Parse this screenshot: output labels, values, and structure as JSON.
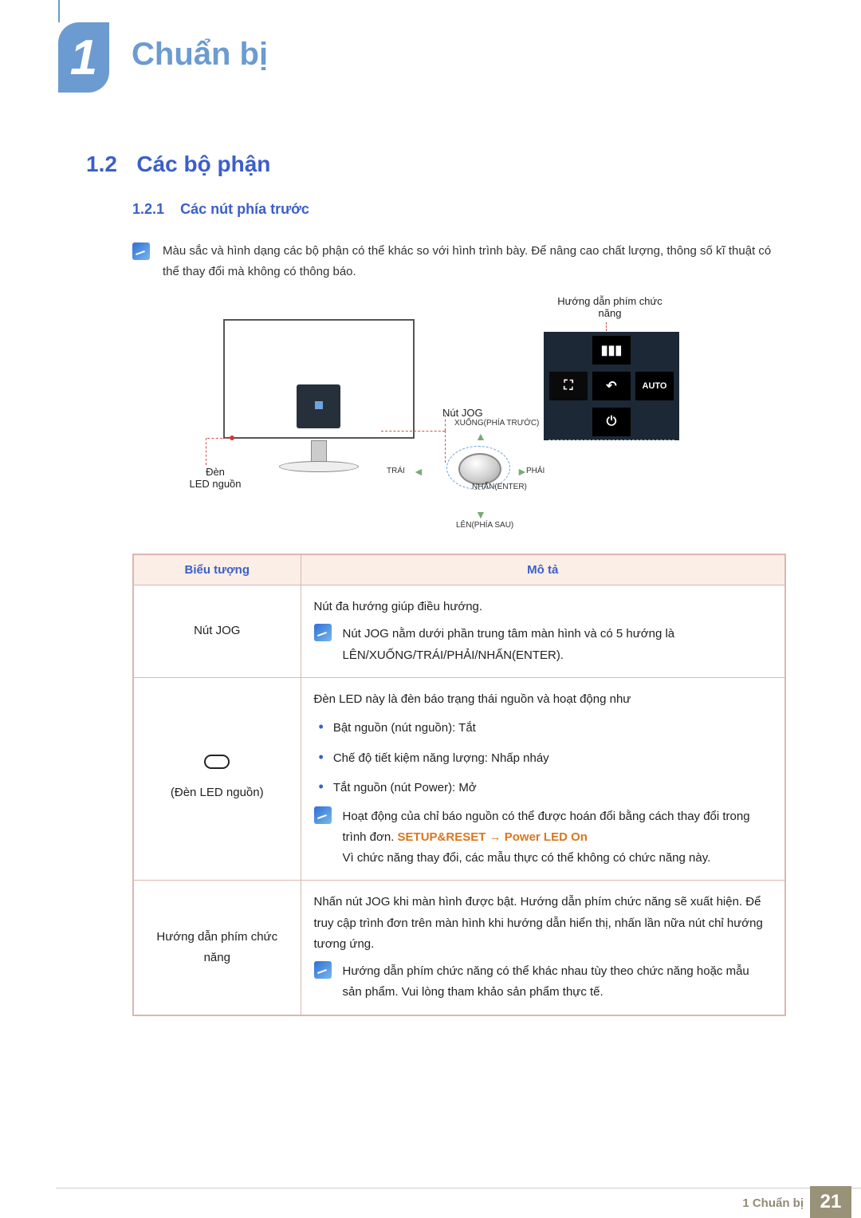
{
  "chapter": {
    "number": "1",
    "title": "Chuẩn bị"
  },
  "section": {
    "number": "1.2",
    "title": "Các bộ phận"
  },
  "subsection": {
    "number": "1.2.1",
    "title": "Các nút phía trước"
  },
  "intro_note": "Màu sắc và hình dạng các bộ phận có thể khác so với hình trình bày. Để nâng cao chất lượng, thông số kĩ thuật có thể thay đổi mà không có thông báo.",
  "diagram": {
    "key_guide_label": "Hướng dẫn phím chức năng",
    "jog_label": "Nút JOG",
    "led_label_line1": "Đèn",
    "led_label_line2": "LED nguồn",
    "osd_auto": "AUTO",
    "osd_return": "Return",
    "directions": {
      "up": "XUỐNG(PHÍA TRƯỚC)",
      "down": "LÊN(PHÍA SAU)",
      "left": "TRÁI",
      "right": "PHẢI",
      "enter": "NHẤN(ENTER)"
    }
  },
  "table": {
    "headers": {
      "icon": "Biểu tượng",
      "desc": "Mô tả"
    },
    "rows": [
      {
        "label": "Nút JOG",
        "desc_main": "Nút đa hướng giúp điều hướng.",
        "note": "Nút JOG nằm dưới phần trung tâm màn hình và có 5 hướng là LÊN/XUỐNG/TRÁI/PHẢI/NHẤN(ENTER)."
      },
      {
        "label": "(Đèn LED nguồn)",
        "desc_main": "Đèn LED này là đèn báo trạng thái nguồn và hoạt động như",
        "bullets": [
          "Bật nguồn (nút nguồn): Tắt",
          "Chế độ tiết kiệm năng lượng: Nhấp nháy",
          "Tắt nguồn (nút Power): Mở"
        ],
        "note_pre": "Hoạt động của chỉ báo nguồn có thể được hoán đổi bằng cách thay đổi trong trình đơn. ",
        "note_orange1": "SETUP&RESET",
        "note_arrow": " → ",
        "note_orange2": "Power LED On",
        "note_post": "Vì chức năng thay đổi, các mẫu thực có thể không có chức năng này."
      },
      {
        "label": "Hướng dẫn phím chức năng",
        "desc_main": "Nhấn nút JOG khi màn hình được bật. Hướng dẫn phím chức năng sẽ xuất hiện. Để truy cập trình đơn trên màn hình khi hướng dẫn hiển thị, nhấn lần nữa nút chỉ hướng tương ứng.",
        "note": "Hướng dẫn phím chức năng có thể khác nhau tùy theo chức năng hoặc mẫu sản phẩm. Vui lòng tham khảo sản phẩm thực tế."
      }
    ]
  },
  "footer": {
    "label": "1 Chuẩn bị",
    "page": "21"
  }
}
